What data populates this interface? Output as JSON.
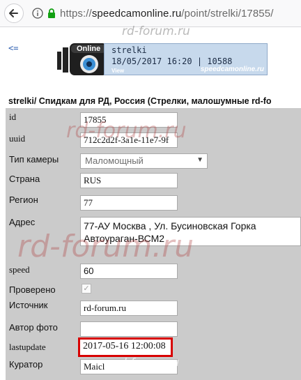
{
  "browser": {
    "url_scheme": "https://",
    "url_host": "speedcamonline.ru",
    "url_path": "/point/strelki/17855/"
  },
  "page": {
    "back_link": "<=",
    "banner": {
      "badge": "Online",
      "name": "strelki",
      "info": "18/05/2017 16:20 | 10588",
      "view": "View",
      "site": "speedcamonline.ru"
    },
    "title": "strelki/ Спидкам для РД, Россия (Стрелки, малошумные rd-fo"
  },
  "form": {
    "id": {
      "label": "id",
      "value": "17855"
    },
    "uuid": {
      "label": "uuid",
      "value": "712c2d2f-3a1e-11e7-9f"
    },
    "camera_type": {
      "label": "Тип камеры",
      "value": "Маломощный"
    },
    "country": {
      "label": "Страна",
      "value": "RUS"
    },
    "region": {
      "label": "Регион",
      "value": "77"
    },
    "address": {
      "label": "Адрес",
      "line1": "77-АУ Москва , Ул. Бусиновская Горка",
      "line2": "Автоураган-ВСМ2"
    },
    "speed": {
      "label": "speed",
      "value": "60"
    },
    "verified": {
      "label": "Проверено",
      "checked": true
    },
    "source": {
      "label": "Источник",
      "value": "rd-forum.ru"
    },
    "photo_author": {
      "label": "Автор фото",
      "value": ""
    },
    "lastupdate": {
      "label": "lastupdate",
      "value": "2017-05-16 12:00:08"
    },
    "curator": {
      "label": "Куратор",
      "value": "Maicl"
    }
  },
  "watermarks": {
    "small": "rd-forum.ru",
    "medium": "rd-forum.ru",
    "large": "rd-forum.ru",
    "bottom": "rd-forum.ru"
  },
  "colors": {
    "highlight": "#d80000",
    "form_background": "#cbcbcb"
  }
}
